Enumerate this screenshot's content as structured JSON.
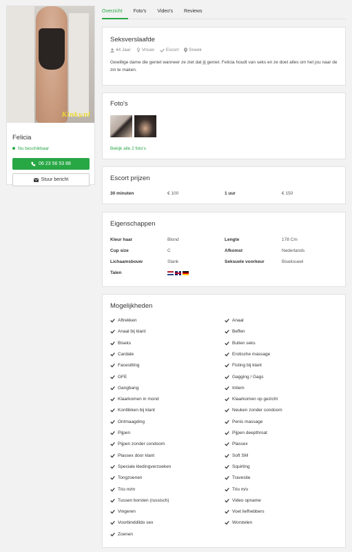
{
  "tabs": [
    "Overzicht",
    "Foto's",
    "Video's",
    "Reviews"
  ],
  "profile": {
    "photo_watermark": "Kinky.nl",
    "name": "Felicia",
    "status": "Nu beschikbaar",
    "phone": "06 23 56 53 88",
    "message_button": "Stuur bericht"
  },
  "intro": {
    "title": "Seksverslaafde",
    "age": "44 Jaar",
    "gender": "Vrouw",
    "type": "Escort",
    "city": "Sneek",
    "description": "Gewillige dame die geniet wanneer ze ziet dat jij geniet. Felicia houdt van seks en ze doet alles om het jou naar de zin te maken."
  },
  "photos": {
    "title": "Foto's",
    "see_all": "Bekijk alle 2 foto's"
  },
  "prices": {
    "title": "Escort prijzen",
    "rows": [
      {
        "label": "30 minuten",
        "value": "€ 100"
      },
      {
        "label": "1 uur",
        "value": "€ 150"
      }
    ]
  },
  "properties": {
    "title": "Eigenschappen",
    "left": [
      {
        "label": "Kleur haar",
        "value": "Blond"
      },
      {
        "label": "Cup size",
        "value": "C"
      },
      {
        "label": "Lichaamsbouw",
        "value": "Slank"
      },
      {
        "label": "Talen",
        "value": ""
      }
    ],
    "right": [
      {
        "label": "Lengte",
        "value": "178 Cm"
      },
      {
        "label": "Afkomst",
        "value": "Nederlands"
      },
      {
        "label": "Seksuele voorkeur",
        "value": "Biseksueel"
      }
    ],
    "languages": [
      "nl-flag",
      "uk-flag",
      "de-flag"
    ]
  },
  "options": {
    "title": "Mogelijkheden",
    "left": [
      "Aftrekken",
      "Anaal bij klant",
      "Biseks",
      "Cardate",
      "Facesitting",
      "GFE",
      "Gangbang",
      "Klaarkomen in mond",
      "Kontlikken bij klant",
      "Ontmaagding",
      "Pijpen",
      "Pijpen zonder condoom",
      "Plassex door klant",
      "Speciale kledingverzoeken",
      "Tongzoenen",
      "Trio m/m",
      "Tussen borsten (russisch)",
      "Vingeren",
      "Voorbinddildo sex",
      "Zoenen"
    ],
    "right": [
      "Anaal",
      "Beffen",
      "Buiten seks",
      "Erotische massage",
      "Fisting bij klant",
      "Gagging / Gags",
      "Intiem",
      "Klaarkomen op gezicht",
      "Neuken zonder condoom",
      "Penis massage",
      "Pijpen deepthroat",
      "Plassex",
      "Soft SM",
      "Squirting",
      "Travestie",
      "Trio m/v",
      "Video opname",
      "Voet liefhebbers",
      "Worstelen"
    ]
  },
  "colors": {
    "accent": "#28a745",
    "background": "#f2f2f2"
  }
}
